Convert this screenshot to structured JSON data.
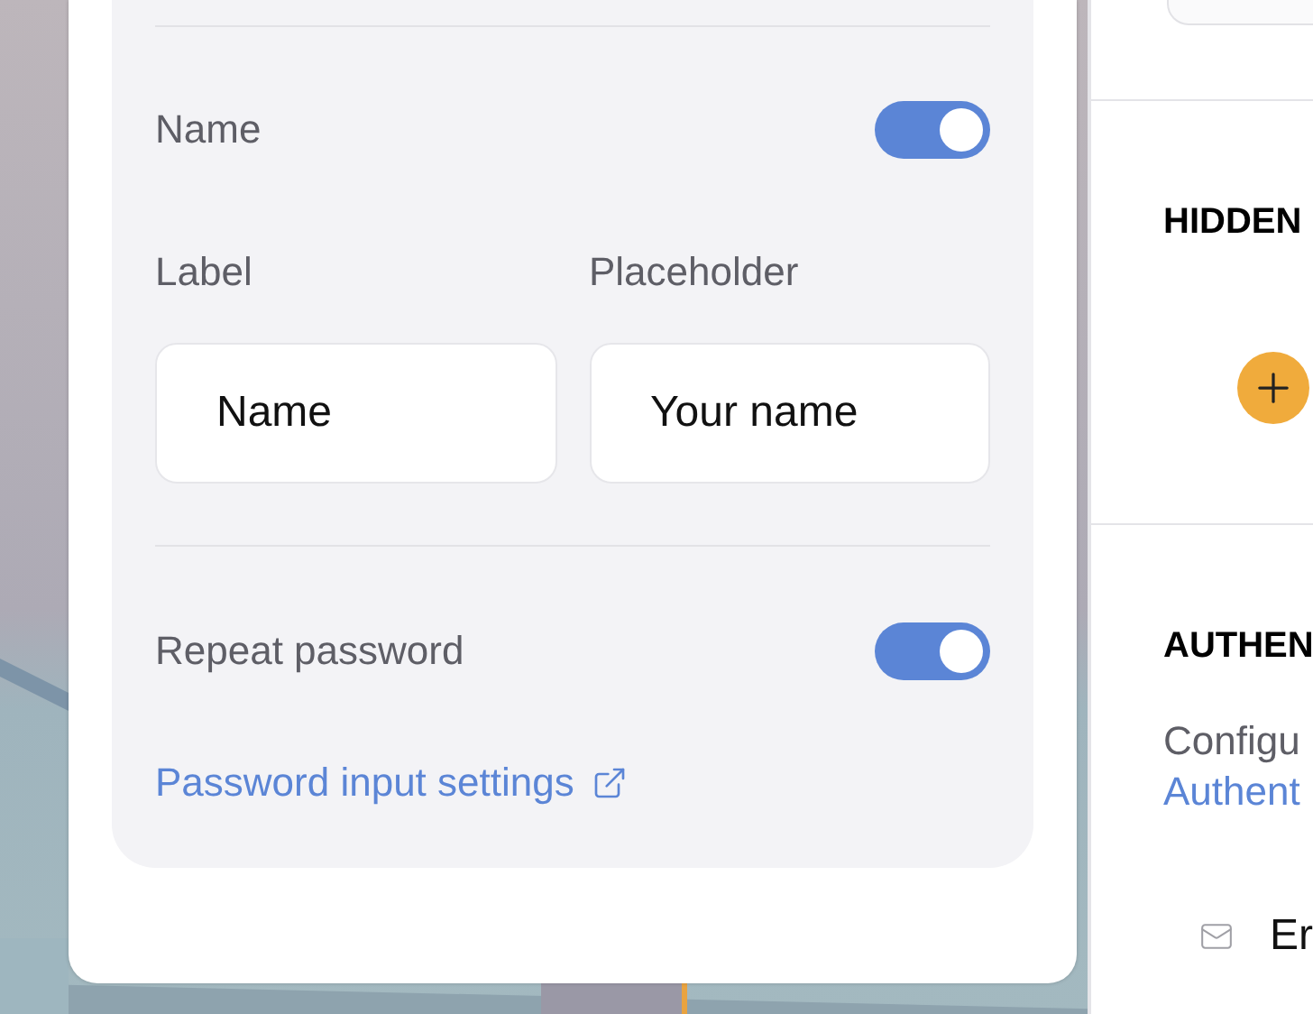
{
  "fields_card": {
    "toggles": [
      {
        "label": "Name",
        "on": true
      },
      {
        "label": "Repeat password",
        "on": true
      }
    ],
    "name_inputs": [
      {
        "label": "Label",
        "value": "Name"
      },
      {
        "label": "Placeholder",
        "value": "Your name"
      }
    ],
    "settings_link": "Password input settings"
  },
  "side_panel": {
    "hidden_heading": "HIDDEN",
    "auth_heading": "AUTHEN",
    "auth_text": "Configu",
    "auth_link": "Authent",
    "methods": [
      {
        "label": "Er"
      }
    ]
  }
}
